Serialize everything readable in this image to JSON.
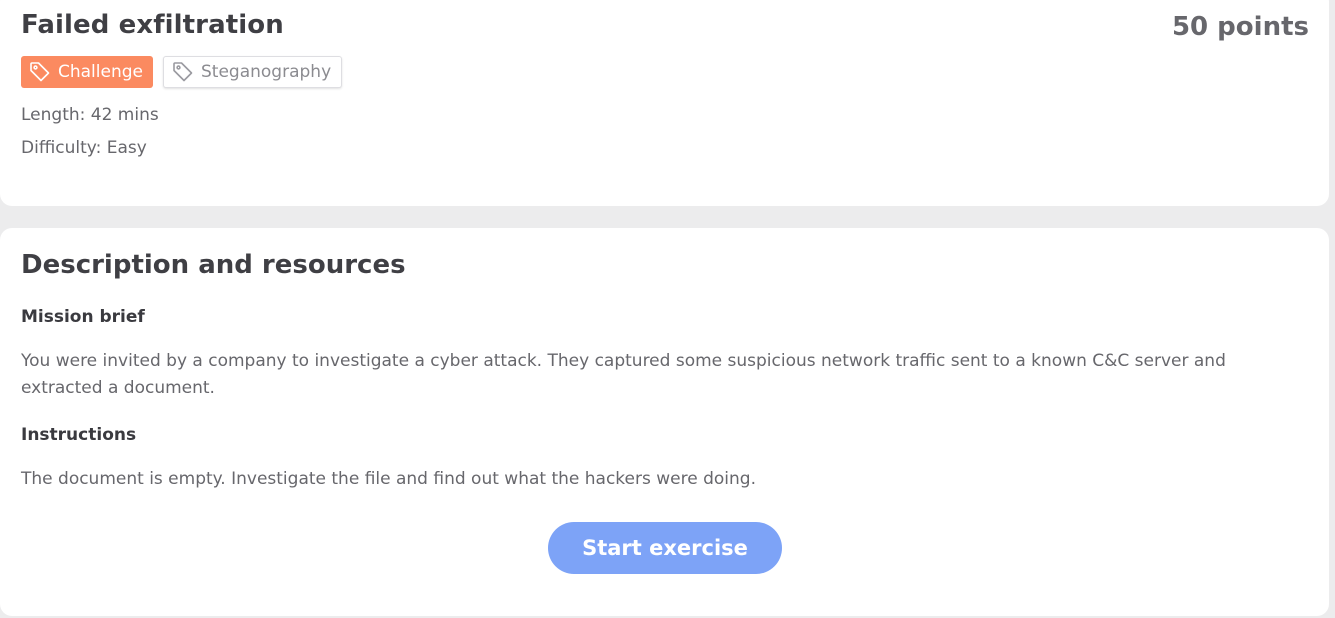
{
  "exercise": {
    "title": "Failed exfiltration",
    "points": "50 points",
    "tags": [
      {
        "label": "Challenge",
        "icon": "tag-icon",
        "color": "#fb8a60"
      },
      {
        "label": "Steganography",
        "icon": "tag-icon"
      }
    ],
    "length": "Length: 42 mins",
    "difficulty": "Difficulty: Easy"
  },
  "description": {
    "title": "Description and resources",
    "brief_heading": "Mission brief",
    "brief_text": "You were invited by a company to investigate a cyber attack. They captured some suspicious network traffic sent to a known C&C server and extracted a document.",
    "instructions_heading": "Instructions",
    "instructions_text": "The document is empty. Investigate the file and find out what the hackers were doing.",
    "start_button": "Start exercise",
    "button_color": "#7da3f7"
  }
}
